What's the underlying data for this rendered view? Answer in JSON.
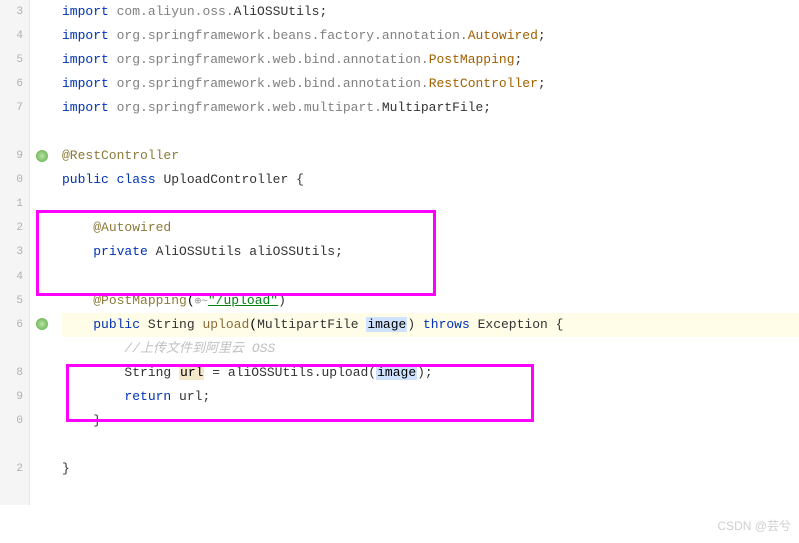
{
  "lines": {
    "l3": {
      "kw": "import",
      "pkg": "com.aliyun.oss.",
      "cls": "AliOSSUtils",
      "semi": ";"
    },
    "l4": {
      "kw": "import",
      "pkg": "org.springframework.beans.factory.annotation.",
      "cls": "Autowired",
      "semi": ";"
    },
    "l5": {
      "kw": "import",
      "pkg": "org.springframework.web.bind.annotation.",
      "cls": "PostMapping",
      "semi": ";"
    },
    "l6": {
      "kw": "import",
      "pkg": "org.springframework.web.bind.annotation.",
      "cls": "RestController",
      "semi": ";"
    },
    "l7": {
      "kw": "import",
      "pkg": "org.springframework.web.multipart.",
      "cls": "MultipartFile",
      "semi": ";"
    },
    "l9": {
      "ann": "@RestController"
    },
    "l10": {
      "kw1": "public",
      "kw2": "class",
      "name": "UploadController",
      "brace": " {"
    },
    "l12": {
      "ann": "@Autowired"
    },
    "l13": {
      "kw": "private",
      "type": "AliOSSUtils",
      "name": "aliOSSUtils",
      "semi": ";"
    },
    "l15": {
      "ann": "@PostMapping",
      "globe": "⊕~",
      "str": "\"/upload\"",
      "close": ")"
    },
    "l16": {
      "kw": "public",
      "ret": "String",
      "method": "upload",
      "ptype": "MultipartFile",
      "pname": "image",
      "close": ")",
      "kw2": "throws",
      "exc": "Exception",
      "brace": " {"
    },
    "l17": {
      "cmt": "//上传文件到阿里云 OSS"
    },
    "l18": {
      "type": "String",
      "var": "url",
      "eq": " = ",
      "obj": "aliOSSUtils",
      "dot": ".upload(",
      "arg": "image",
      "close": ");"
    },
    "l19": {
      "kw": "return",
      "var": "url",
      "semi": ";"
    },
    "l20": {
      "brace": "}"
    },
    "l22": {
      "brace": "}"
    }
  },
  "gutter": [
    "3",
    "4",
    "5",
    "6",
    "7",
    " ",
    "9",
    "0",
    "1",
    "2",
    "3",
    "4",
    "5",
    "6",
    " ",
    "8",
    "9",
    "0",
    " ",
    "2",
    " "
  ],
  "watermark": "CSDN @芸兮"
}
